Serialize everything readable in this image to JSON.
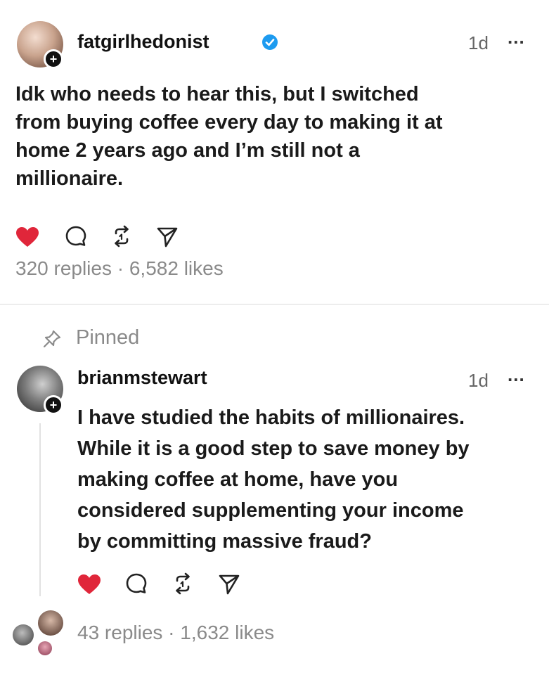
{
  "post": {
    "username": "fatgirlhedonist",
    "time": "1d",
    "more": "...",
    "lines": [
      "Idk who needs to hear this, but I switched",
      "from buying coffee every day to making it at",
      "home 2 years ago and I’m still not a",
      "millionaire."
    ],
    "stats": "320 replies · 6,582 likes"
  },
  "reply": {
    "pinned_label": "Pinned",
    "username": "brianmstewart",
    "time": "1d",
    "more": "...",
    "lines": [
      "I have studied the habits of millionaires.",
      "While it is a good step to save money by",
      "making coffee at home, have you",
      "considered supplementing your income",
      "by committing massive fraud?"
    ],
    "stats": "43 replies · 1,632 likes"
  },
  "icons": [
    "heart-icon",
    "comment-icon",
    "repost-icon",
    "share-icon",
    "pin-icon",
    "verified-icon"
  ],
  "colors": {
    "like": "#e0263a",
    "verified": "#1d9bf0",
    "muted": "#8a8a8a"
  }
}
